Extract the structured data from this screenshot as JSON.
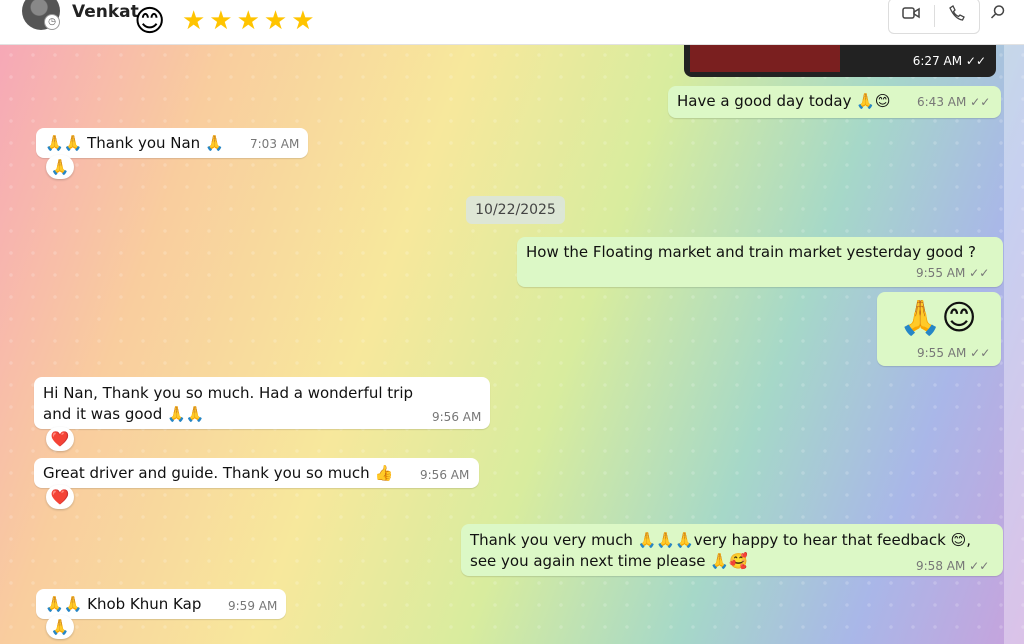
{
  "header": {
    "contact_name": "Venkat",
    "emoji": "😊",
    "stars": "★★★★★",
    "video_call_icon": "video-camera-icon",
    "voice_call_icon": "phone-icon",
    "search_icon": "search-icon"
  },
  "photo": {
    "time": "6:27 AM ✓✓"
  },
  "date_separator": "10/22/2025",
  "messages": [
    {
      "text": "Have a good day today 🙏😊",
      "time": "6:43 AM",
      "tick": "✓✓"
    },
    {
      "text": "🙏🙏 Thank you Nan 🙏",
      "time": "7:03 AM",
      "reaction": "🙏"
    },
    {
      "text": "How the Floating market and train market yesterday good ?",
      "time": "9:55 AM",
      "tick": "✓✓"
    },
    {
      "text": "🙏😊",
      "time": "9:55 AM",
      "tick": "✓✓"
    },
    {
      "text": "Hi Nan, Thank you so much. Had a wonderful trip and it was good 🙏🙏",
      "time": "9:56 AM",
      "reaction": "❤️"
    },
    {
      "text": "Great driver and guide. Thank you so much 👍",
      "time": "9:56 AM",
      "reaction": "❤️"
    },
    {
      "text": "Thank you very much 🙏🙏🙏very happy to hear that feedback 😊, see you again next time please 🙏🥰",
      "time": "9:58 AM",
      "tick": "✓✓"
    },
    {
      "text": "🙏🙏 Khob Khun Kap",
      "time": "9:59 AM",
      "reaction": "🙏"
    }
  ],
  "colors": {
    "outgoing_bubble": "#dcf8c6",
    "incoming_bubble": "#ffffff"
  }
}
